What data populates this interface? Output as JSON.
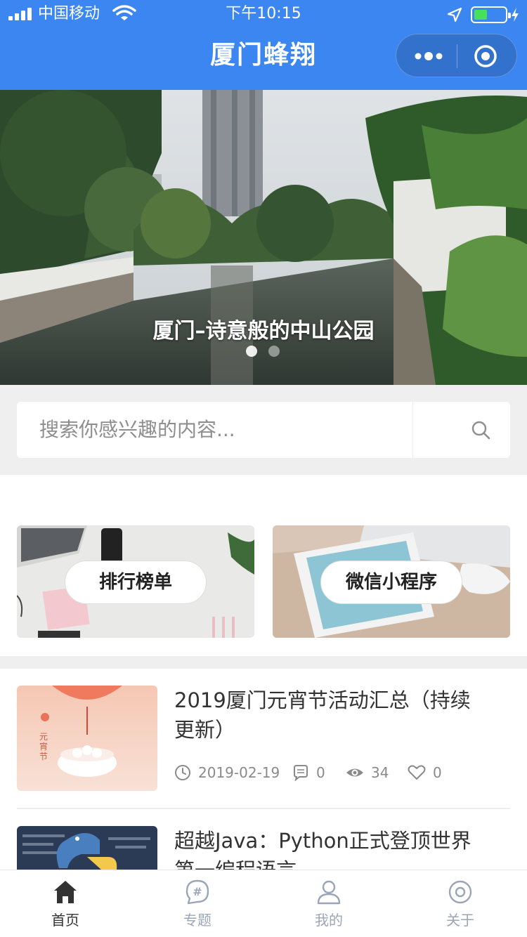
{
  "status_bar": {
    "carrier": "中国移动",
    "time": "下午10:15"
  },
  "nav": {
    "title": "厦门蜂翔"
  },
  "banner": {
    "caption": "厦门–诗意般的中山公园",
    "indicator_count": 2,
    "active_index": 0
  },
  "search": {
    "placeholder": "搜索你感兴趣的内容..."
  },
  "categories": [
    {
      "label": "排行榜单"
    },
    {
      "label": "微信小程序"
    }
  ],
  "articles": [
    {
      "title": "2019厦门元宵节活动汇总（持续更新）",
      "thumb_text": "元宵节",
      "date": "2019-02-19",
      "comments": "0",
      "views": "34",
      "likes": "0"
    },
    {
      "title": "超越Java：Python正式登顶世界第一编程语言"
    }
  ],
  "tabbar": {
    "items": [
      {
        "label": "首页",
        "icon": "home-icon",
        "active": true
      },
      {
        "label": "专题",
        "icon": "topic-icon",
        "active": false
      },
      {
        "label": "我的",
        "icon": "user-icon",
        "active": false
      },
      {
        "label": "关于",
        "icon": "about-icon",
        "active": false
      }
    ]
  },
  "colors": {
    "brand": "#3b86f0",
    "tab_active": "#333333",
    "tab_inactive": "#9aa6b8"
  }
}
